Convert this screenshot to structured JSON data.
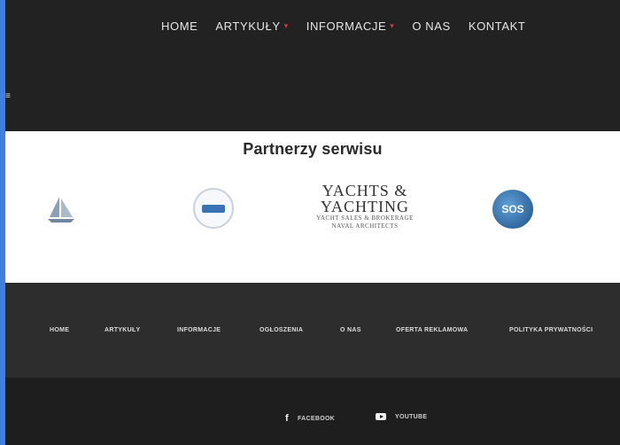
{
  "nav": {
    "items": [
      {
        "label": "HOME",
        "has_dropdown": false
      },
      {
        "label": "ARTYKUŁY",
        "has_dropdown": true
      },
      {
        "label": "INFORMACJE",
        "has_dropdown": true
      },
      {
        "label": "O NAS",
        "has_dropdown": false
      },
      {
        "label": "KONTAKT",
        "has_dropdown": false
      }
    ],
    "dropdown_color": "#d43a3a"
  },
  "partners": {
    "title": "Partnerzy serwisu",
    "logos": [
      {
        "icon": "sailboat-logo"
      },
      {
        "icon": "circle-badge-logo"
      },
      {
        "icon": "yachts-and-yachting-logo",
        "line1": "YACHTS &",
        "line2": "YACHTING",
        "sub1": "YACHT SALES & BROKERAGE",
        "sub2": "NAVAL ARCHITECTS"
      },
      {
        "icon": "globe-logo",
        "text": "SOS"
      }
    ]
  },
  "footer_nav": {
    "items": [
      {
        "label": "HOME"
      },
      {
        "label": "ARTYKUŁY"
      },
      {
        "label": "INFORMACJE"
      },
      {
        "label": "OGŁOSZENIA"
      },
      {
        "label": "O NAS"
      },
      {
        "label": "OFERTA REKLAMOWA"
      },
      {
        "label": "POLITYKA PRYWATNOŚCI"
      }
    ]
  },
  "social": {
    "facebook_label": "FACEBOOK",
    "youtube_label": "YOUTUBE"
  }
}
